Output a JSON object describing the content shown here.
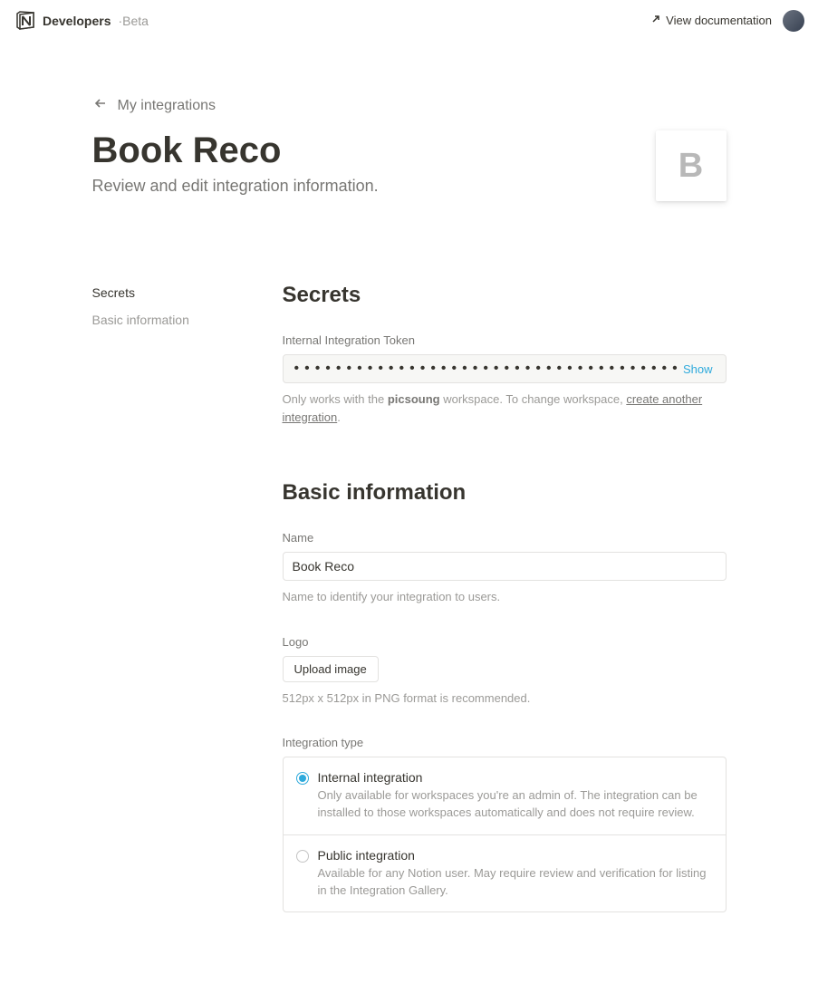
{
  "header": {
    "developers_label": "Developers",
    "beta_label": "·Beta",
    "view_docs_label": "View documentation"
  },
  "breadcrumb": {
    "label": "My integrations"
  },
  "page": {
    "title": "Book Reco",
    "subtitle": "Review and edit integration information.",
    "icon_letter": "B"
  },
  "sidebar": {
    "items": [
      {
        "label": "Secrets",
        "active": true
      },
      {
        "label": "Basic information",
        "active": false
      }
    ]
  },
  "secrets": {
    "heading": "Secrets",
    "token_label": "Internal Integration Token",
    "token_masked": "••••••••••••••••••••••••••••••••••••••••••••••",
    "show_label": "Show",
    "helper_pre": "Only works with the ",
    "workspace": "picsoung",
    "helper_mid": " workspace. To change workspace, ",
    "link_text": "create another integration",
    "helper_post": "."
  },
  "basic": {
    "heading": "Basic information",
    "name_label": "Name",
    "name_value": "Book Reco",
    "name_helper": "Name to identify your integration to users.",
    "logo_label": "Logo",
    "upload_label": "Upload image",
    "logo_helper": "512px x 512px in PNG format is recommended.",
    "type_label": "Integration type",
    "options": [
      {
        "title": "Internal integration",
        "desc": "Only available for workspaces you're an admin of. The integration can be installed to those workspaces automatically and does not require review.",
        "selected": true
      },
      {
        "title": "Public integration",
        "desc": "Available for any Notion user. May require review and verification for listing in the Integration Gallery.",
        "selected": false
      }
    ]
  }
}
